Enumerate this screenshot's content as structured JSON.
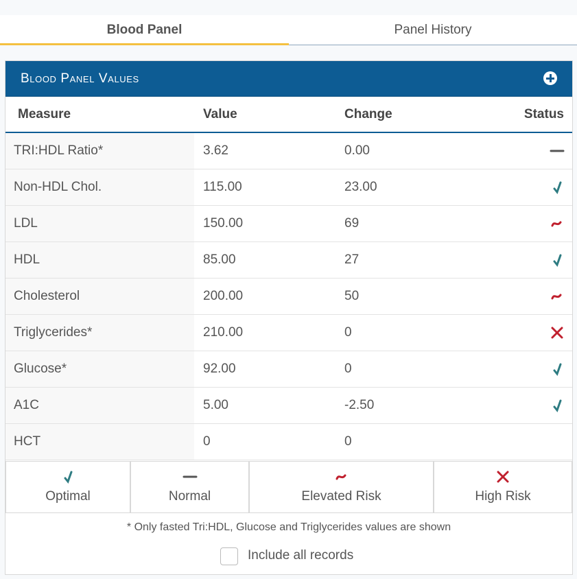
{
  "tabs": [
    {
      "label": "Blood Panel",
      "active": true
    },
    {
      "label": "Panel History",
      "active": false
    }
  ],
  "panel": {
    "title": "Blood Panel Values",
    "add_icon": "plus-circle-icon"
  },
  "table": {
    "headers": {
      "measure": "Measure",
      "value": "Value",
      "change": "Change",
      "status": "Status"
    },
    "rows": [
      {
        "measure": "TRI:HDL Ratio*",
        "value": "3.62",
        "change": "0.00",
        "status": "normal"
      },
      {
        "measure": "Non-HDL Chol.",
        "value": "115.00",
        "change": "23.00",
        "status": "optimal"
      },
      {
        "measure": "LDL",
        "value": "150.00",
        "change": "69",
        "status": "elevated"
      },
      {
        "measure": "HDL",
        "value": "85.00",
        "change": "27",
        "status": "optimal"
      },
      {
        "measure": "Cholesterol",
        "value": "200.00",
        "change": "50",
        "status": "elevated"
      },
      {
        "measure": "Triglycerides*",
        "value": "210.00",
        "change": "0",
        "status": "high"
      },
      {
        "measure": "Glucose*",
        "value": "92.00",
        "change": "0",
        "status": "optimal"
      },
      {
        "measure": "A1C",
        "value": "5.00",
        "change": "-2.50",
        "status": "optimal"
      },
      {
        "measure": "HCT",
        "value": "0",
        "change": "0",
        "status": ""
      }
    ]
  },
  "legend": [
    {
      "key": "optimal",
      "label": "Optimal",
      "icon": "check-icon",
      "color": "#2e7c82"
    },
    {
      "key": "normal",
      "label": "Normal",
      "icon": "dash-icon",
      "color": "#555555"
    },
    {
      "key": "elevated",
      "label": "Elevated Risk",
      "icon": "tilde-icon",
      "color": "#c0202e"
    },
    {
      "key": "high",
      "label": "High Risk",
      "icon": "x-icon",
      "color": "#c0202e"
    }
  ],
  "footnote": "* Only fasted Tri:HDL, Glucose and Triglycerides values are shown",
  "include_all": {
    "label": "Include all records",
    "checked": false
  },
  "colors": {
    "header_bg": "#0d5c94",
    "tab_accent": "#f4c040"
  }
}
